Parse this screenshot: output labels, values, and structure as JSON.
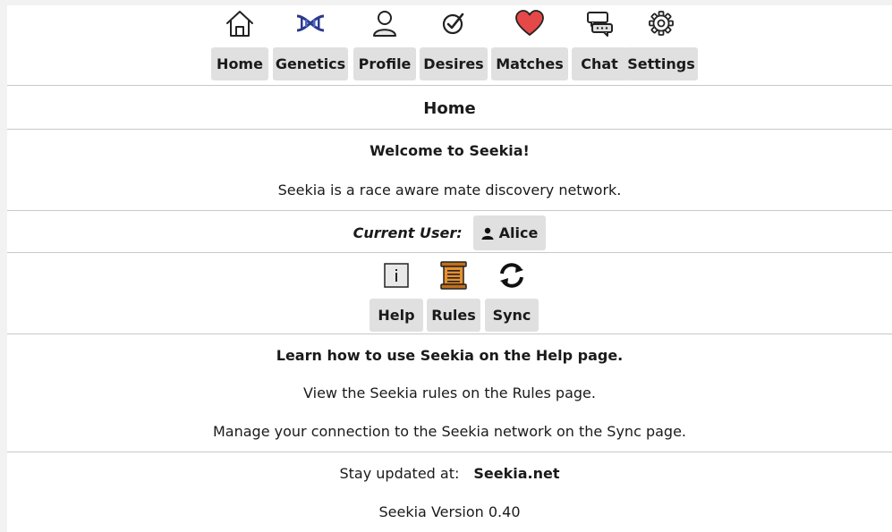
{
  "nav": {
    "items": [
      {
        "label": "Home",
        "icon": "house-icon"
      },
      {
        "label": "Genetics",
        "icon": "dna-icon"
      },
      {
        "label": "Profile",
        "icon": "user-icon"
      },
      {
        "label": "Desires",
        "icon": "check-circle-icon"
      },
      {
        "label": "Matches",
        "icon": "heart-icon"
      },
      {
        "label": "Chat",
        "icon": "chat-bubbles-icon"
      },
      {
        "label": "Settings",
        "icon": "gear-icon"
      }
    ]
  },
  "page": {
    "title": "Home",
    "welcome_heading": "Welcome to Seekia!",
    "welcome_text": "Seekia is a race aware mate discovery network."
  },
  "user": {
    "label": "Current User:",
    "name": "Alice"
  },
  "pages": {
    "items": [
      {
        "label": "Help",
        "icon": "info-icon"
      },
      {
        "label": "Rules",
        "icon": "scroll-icon"
      },
      {
        "label": "Sync",
        "icon": "sync-icon"
      }
    ]
  },
  "info": {
    "help_text": "Learn how to use Seekia on the Help page.",
    "rules_text": "View the Seekia rules on the Rules page.",
    "sync_text": "Manage your connection to the Seekia network on the Sync page."
  },
  "footer": {
    "updated_label": "Stay updated at:",
    "website": "Seekia.net",
    "version": "Seekia Version 0.40"
  },
  "colors": {
    "button_bg": "#e0e0e0",
    "heart": "#e54848",
    "dna": "#2b3a8c",
    "scroll": "#e8902e"
  }
}
